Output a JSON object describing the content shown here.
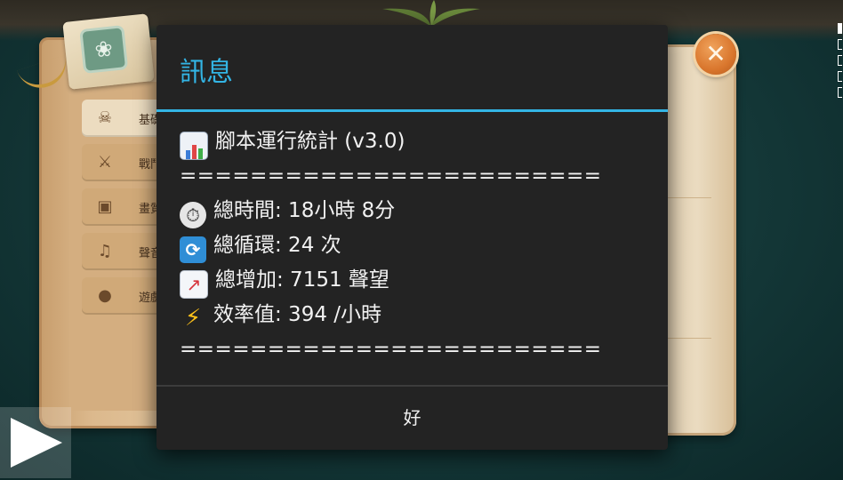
{
  "game": {
    "menu_items": [
      {
        "label": "基礎",
        "icon": "skull-icon"
      },
      {
        "label": "戰鬥",
        "icon": "crossed-swords-icon"
      },
      {
        "label": "畫質",
        "icon": "image-icon"
      },
      {
        "label": "聲音",
        "icon": "music-icon"
      },
      {
        "label": "遊戲",
        "icon": "chat-bubble-icon"
      }
    ],
    "close_icon": "close-x-icon",
    "play_icon": "play-icon"
  },
  "dialog": {
    "title": "訊息",
    "heading": "腳本運行統計 (v3.0)",
    "separator": "========================",
    "stats": [
      {
        "icon": "stopwatch-icon",
        "text": "總時間: 18小時 8分"
      },
      {
        "icon": "cycle-arrows-icon",
        "text": "總循環: 24 次"
      },
      {
        "icon": "chart-increasing-icon",
        "text": "總增加: 7151 聲望"
      },
      {
        "icon": "lightning-icon",
        "text": "效率值: 394 /小時"
      }
    ],
    "ok_label": "好"
  },
  "colors": {
    "dialog_bg": "#232323",
    "accent": "#33b5e5",
    "text": "#f2f2f2"
  }
}
